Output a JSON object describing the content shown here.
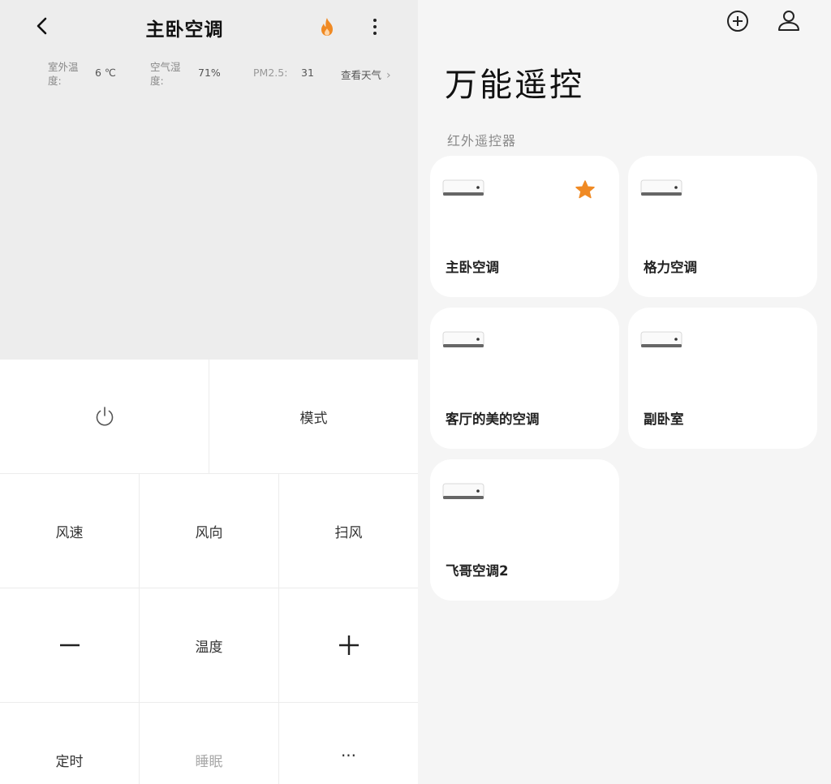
{
  "left": {
    "title": "主卧空调",
    "weather": {
      "outdoor_temp_label": "室外温度:",
      "outdoor_temp_value": "6 ℃",
      "humidity_label": "空气湿度:",
      "humidity_value": "71%",
      "pm25_label": "PM2.5:",
      "pm25_value": "31",
      "view_weather": "查看天气"
    },
    "controls": {
      "mode": "模式",
      "fan_speed": "风速",
      "fan_direction": "风向",
      "swing": "扫风",
      "temperature": "温度",
      "timer": "定时",
      "sleep": "睡眠",
      "more": "···"
    },
    "icons": {
      "back": "chevron-left-icon",
      "fire": "flame-icon",
      "more": "more-vertical-icon",
      "power": "power-icon",
      "minus": "minus-icon",
      "plus": "plus-icon"
    },
    "accent_color": "#f08a24"
  },
  "right": {
    "title": "万能遥控",
    "section": "红外遥控器",
    "devices": [
      {
        "name": "主卧空调",
        "favorite": true
      },
      {
        "name": "格力空调",
        "favorite": false
      },
      {
        "name": "客厅的美的空调",
        "favorite": false
      },
      {
        "name": "副卧室",
        "favorite": false
      },
      {
        "name": "飞哥空调2",
        "favorite": false
      }
    ],
    "icons": {
      "add": "plus-circle-icon",
      "user": "user-icon",
      "device": "air-conditioner-icon",
      "favorite": "star-icon"
    }
  }
}
